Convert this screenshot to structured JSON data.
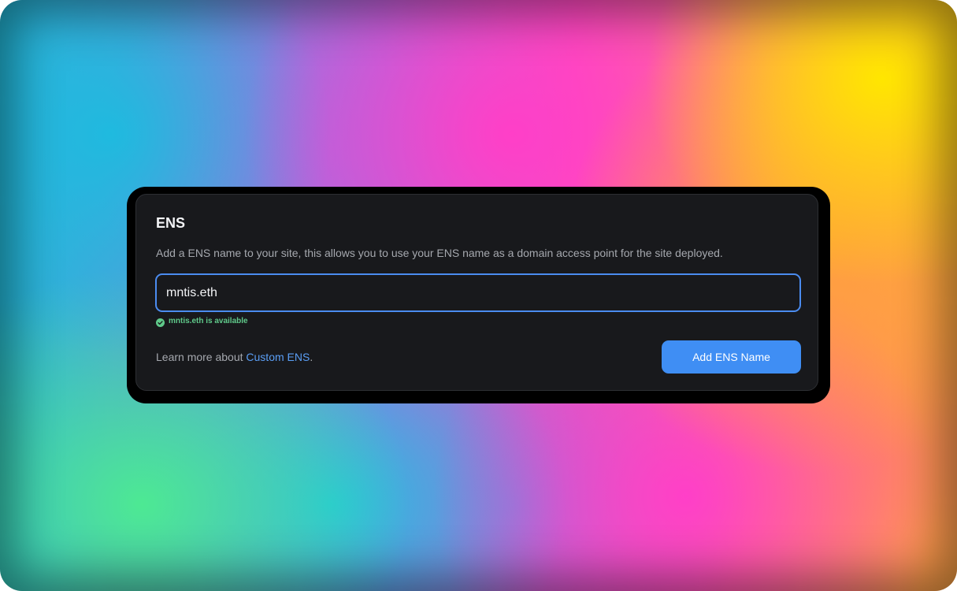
{
  "ens_card": {
    "title": "ENS",
    "description": "Add a ENS name to your site, this allows you to use your ENS name as a domain access point for the site deployed.",
    "input_value": "mntis.eth",
    "availability_text": "mntis.eth is available",
    "availability_icon": "check-circle-icon",
    "learn_more_prefix": "Learn more about ",
    "learn_more_link": "Custom ENS",
    "learn_more_suffix": ".",
    "add_button_label": "Add ENS Name"
  },
  "colors": {
    "card_background": "#18191c",
    "accent": "#3f8ef4",
    "input_focus_border": "#4b8cf0",
    "link": "#5a9ef5",
    "success": "#5fc98a"
  }
}
